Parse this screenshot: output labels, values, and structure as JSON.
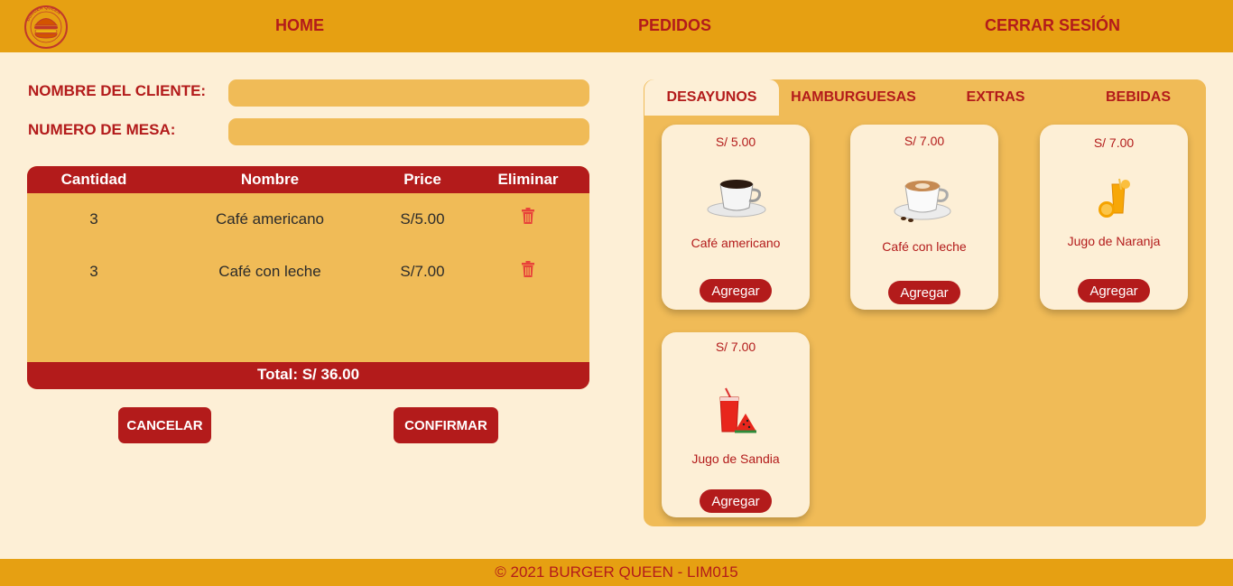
{
  "header": {
    "logo_text": "BURGER QUEEN",
    "nav": {
      "home": "HOME",
      "orders": "PEDIDOS",
      "logout": "CERRAR SESIÓN"
    }
  },
  "form": {
    "client_label": "NOMBRE DEL CLIENTE:",
    "client_value": "",
    "table_label": "NUMERO DE MESA:",
    "table_value": ""
  },
  "order": {
    "columns": [
      "Cantidad",
      "Nombre",
      "Price",
      "Eliminar"
    ],
    "rows": [
      {
        "qty": "3",
        "name": "Café americano",
        "price": "S/5.00"
      },
      {
        "qty": "3",
        "name": "Café con leche",
        "price": "S/7.00"
      }
    ],
    "total": "Total: S/ 36.00"
  },
  "buttons": {
    "cancel": "CANCELAR",
    "confirm": "CONFIRMAR"
  },
  "menu": {
    "tabs": [
      "DESAYUNOS",
      "HAMBURGUESAS",
      "EXTRAS",
      "BEBIDAS"
    ],
    "active_tab": "DESAYUNOS",
    "add_label": "Agregar",
    "products": [
      {
        "price": "S/ 5.00",
        "name": "Café americano",
        "icon": "coffee-cup-icon"
      },
      {
        "price": "S/ 7.00",
        "name": "Café con leche",
        "icon": "latte-cup-icon"
      },
      {
        "price": "S/ 7.00",
        "name": "Jugo de Naranja",
        "icon": "orange-juice-icon"
      },
      {
        "price": "S/ 7.00",
        "name": "Jugo de Sandia",
        "icon": "watermelon-juice-icon"
      }
    ]
  },
  "footer": {
    "text": "© 2021 BURGER QUEEN - LIM015"
  },
  "colors": {
    "background": "#fdefd6",
    "header": "#e6a012",
    "panel": "#f0bb57",
    "accent_red": "#b31b1b",
    "trash_icon": "#e8433a"
  }
}
